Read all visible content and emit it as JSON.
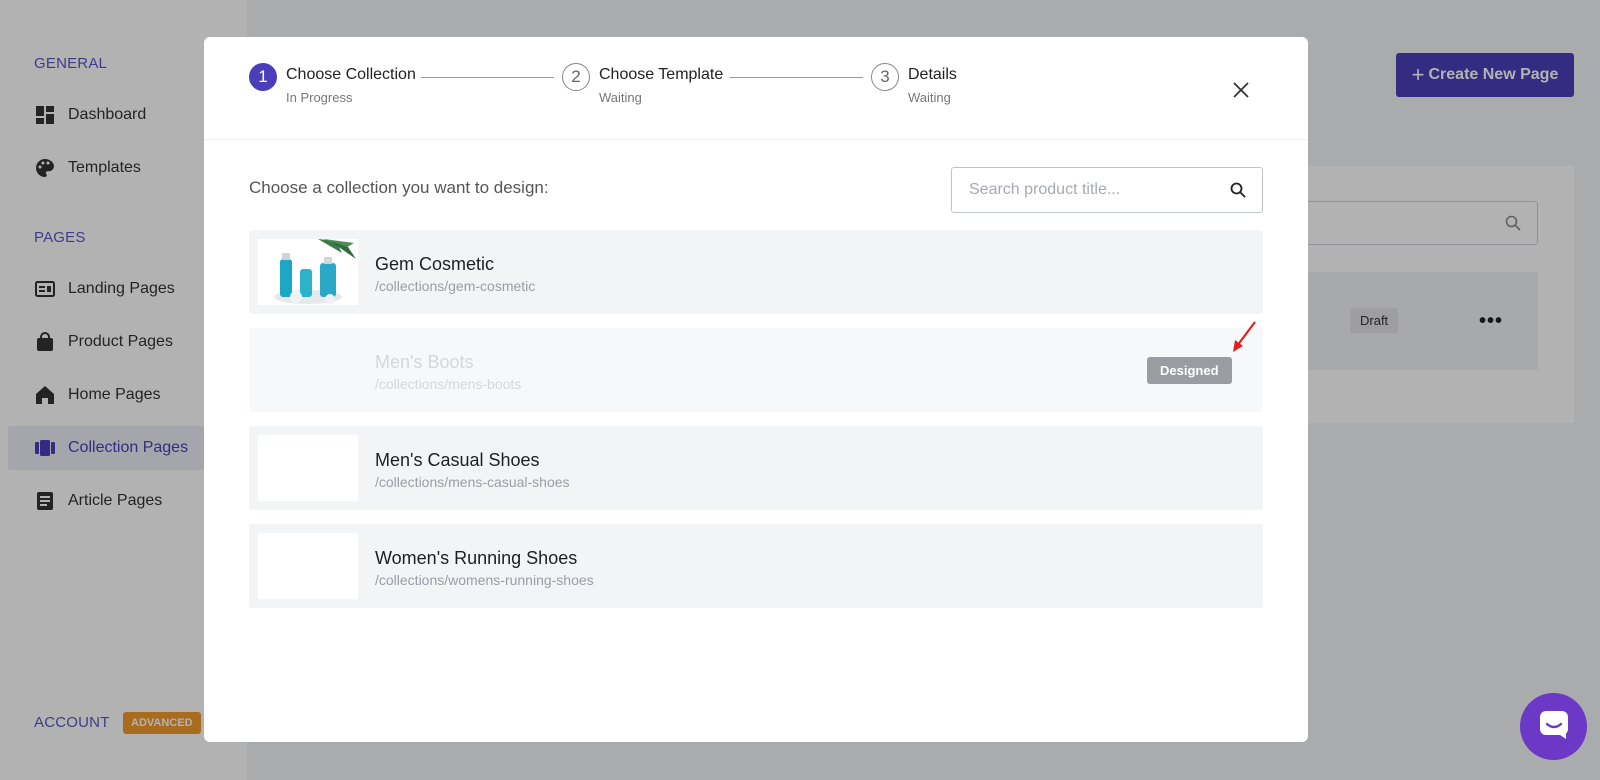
{
  "sidebar": {
    "sections": {
      "general": "GENERAL",
      "pages": "PAGES",
      "account": "ACCOUNT"
    },
    "account_badge": "ADVANCED",
    "items": [
      {
        "label": "Dashboard",
        "icon": "dashboard-icon"
      },
      {
        "label": "Templates",
        "icon": "palette-icon"
      },
      {
        "label": "Landing Pages",
        "icon": "landing-icon"
      },
      {
        "label": "Product Pages",
        "icon": "bag-icon"
      },
      {
        "label": "Home Pages",
        "icon": "home-icon"
      },
      {
        "label": "Collection Pages",
        "icon": "collection-icon",
        "active": true
      },
      {
        "label": "Article Pages",
        "icon": "article-icon"
      }
    ]
  },
  "main": {
    "create_button": "Create New Page",
    "row_status": "Draft"
  },
  "modal": {
    "steps": [
      {
        "number": "1",
        "title": "Choose Collection",
        "status": "In Progress"
      },
      {
        "number": "2",
        "title": "Choose Template",
        "status": "Waiting"
      },
      {
        "number": "3",
        "title": "Details",
        "status": "Waiting"
      }
    ],
    "prompt": "Choose a collection you want to design:",
    "search": {
      "placeholder": "Search product title...",
      "value": ""
    },
    "collections": [
      {
        "name": "Gem Cosmetic",
        "path": "/collections/gem-cosmetic"
      },
      {
        "name": "Men's Boots",
        "path": "/collections/mens-boots",
        "badge": "Designed"
      },
      {
        "name": "Men's Casual Shoes",
        "path": "/collections/mens-casual-shoes"
      },
      {
        "name": "Women's Running Shoes",
        "path": "/collections/womens-running-shoes"
      }
    ]
  },
  "colors": {
    "accent": "#4a3fb8",
    "overlay": "rgba(0,0,0,0.3)",
    "badge_advanced": "#f29b2c",
    "chat": "#6b39c5"
  }
}
